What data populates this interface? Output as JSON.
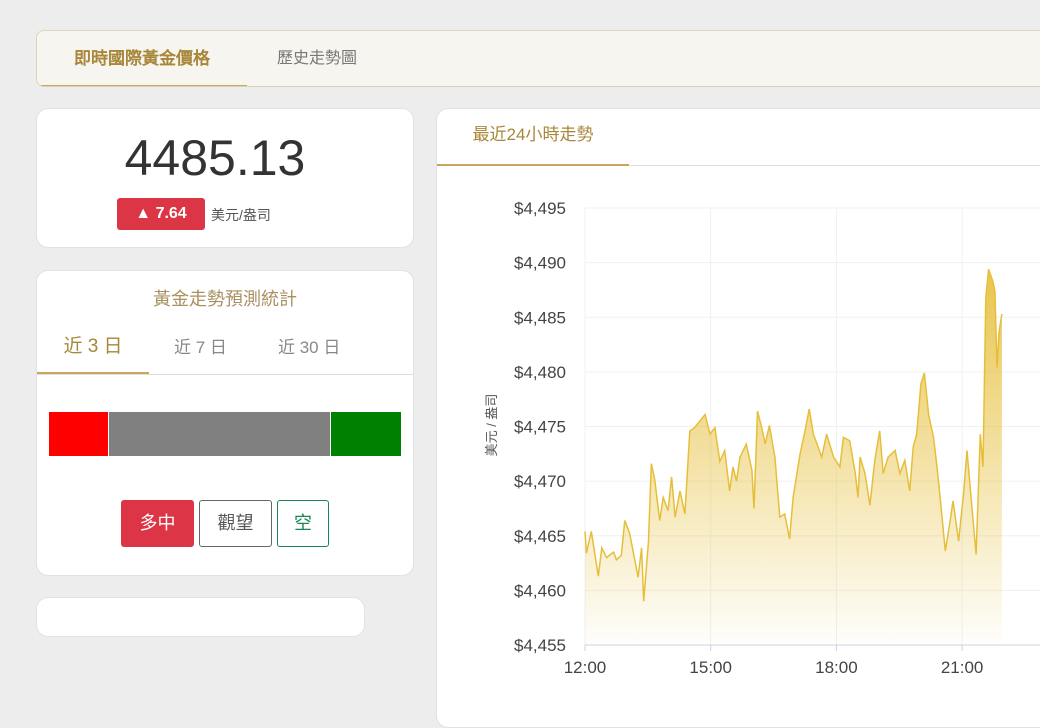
{
  "tabs": [
    {
      "label": "即時國際黃金價格",
      "active": true
    },
    {
      "label": "歷史走勢圖",
      "active": false
    }
  ],
  "price": {
    "value": "4485.13",
    "change": "▲ 7.64",
    "unit": "美元/盎司",
    "change_color": "#dc3545"
  },
  "forecast": {
    "title": "黃金走勢預測統計",
    "tabs": [
      "近 3 日",
      "近 7 日",
      "近 30 日"
    ],
    "distribution": [
      {
        "label": "多",
        "fraction": 0.17,
        "color": "#ff0000"
      },
      {
        "label": "中",
        "fraction": 0.63,
        "color": "#808080"
      },
      {
        "label": "空",
        "fraction": 0.2,
        "color": "#008000"
      }
    ],
    "buttons": [
      "多中",
      "觀望",
      "空"
    ]
  },
  "chart_tab": "最近24小時走勢",
  "chart_data": {
    "type": "area",
    "title": "最近24小時走勢",
    "ylabel": "美元 / 盎司",
    "ylim": [
      4455,
      4495
    ],
    "yticks": [
      "$4,455",
      "$4,460",
      "$4,465",
      "$4,470",
      "$4,475",
      "$4,480",
      "$4,485",
      "$4,490",
      "$4,495"
    ],
    "xticks": [
      "12:00",
      "15:00",
      "18:00",
      "21:00"
    ],
    "x_minutes_from_12": [
      0,
      2,
      9,
      19,
      24,
      31,
      41,
      45,
      52,
      57,
      64,
      76,
      81,
      84,
      91,
      95,
      100,
      107,
      112,
      119,
      124,
      129,
      136,
      143,
      150,
      157,
      172,
      179,
      186,
      193,
      200,
      207,
      212,
      217,
      222,
      231,
      239,
      242,
      247,
      253,
      258,
      264,
      272,
      279,
      286,
      293,
      298,
      308,
      315,
      321,
      327,
      334,
      339,
      346,
      356,
      365,
      370,
      379,
      387,
      391,
      394,
      401,
      408,
      415,
      422,
      427,
      434,
      444,
      451,
      458,
      465,
      470,
      475,
      481,
      486,
      492,
      499,
      504,
      508,
      516,
      523,
      527,
      535,
      542,
      547,
      554,
      560,
      566,
      570,
      574,
      578,
      584,
      587,
      590,
      593,
      597
    ],
    "values": [
      4465.4,
      4463.4,
      4465.4,
      4461.3,
      4463.9,
      4463,
      4463.5,
      4462.8,
      4463.2,
      4466.4,
      4465.2,
      4461.2,
      4463.9,
      4459.0,
      4464.5,
      4471.6,
      4470.1,
      4466.4,
      4468.5,
      4467.3,
      4470.4,
      4466.7,
      4469.1,
      4467,
      4474.6,
      4474.9,
      4476.1,
      4474.3,
      4474.9,
      4471.8,
      4472.8,
      4469.1,
      4471.3,
      4470,
      4472.2,
      4473.4,
      4471,
      4467.5,
      4476.4,
      4474.9,
      4473.4,
      4475.1,
      4472.2,
      4466.7,
      4467,
      4464.7,
      4468.5,
      4472.5,
      4474.6,
      4476.6,
      4474.3,
      4473.1,
      4472.2,
      4474.3,
      4472.2,
      4471.3,
      4474,
      4473.7,
      4470.7,
      4468.5,
      4472.2,
      4470.7,
      4467.8,
      4471.9,
      4474.6,
      4470.7,
      4472.2,
      4472.8,
      4470.7,
      4471.9,
      4469.1,
      4473.1,
      4474.3,
      4478.9,
      4479.9,
      4476.1,
      4474,
      4471.3,
      4468.8,
      4463.6,
      4466.4,
      4468.2,
      4464.5,
      4468.8,
      4472.8,
      4467.6,
      4463.3,
      4474.3,
      4471.3,
      4486.8,
      4489.4,
      4488.3,
      4487.4,
      4480.4,
      4483.7,
      4485.3
    ],
    "line_color": "#e6bf3a"
  }
}
